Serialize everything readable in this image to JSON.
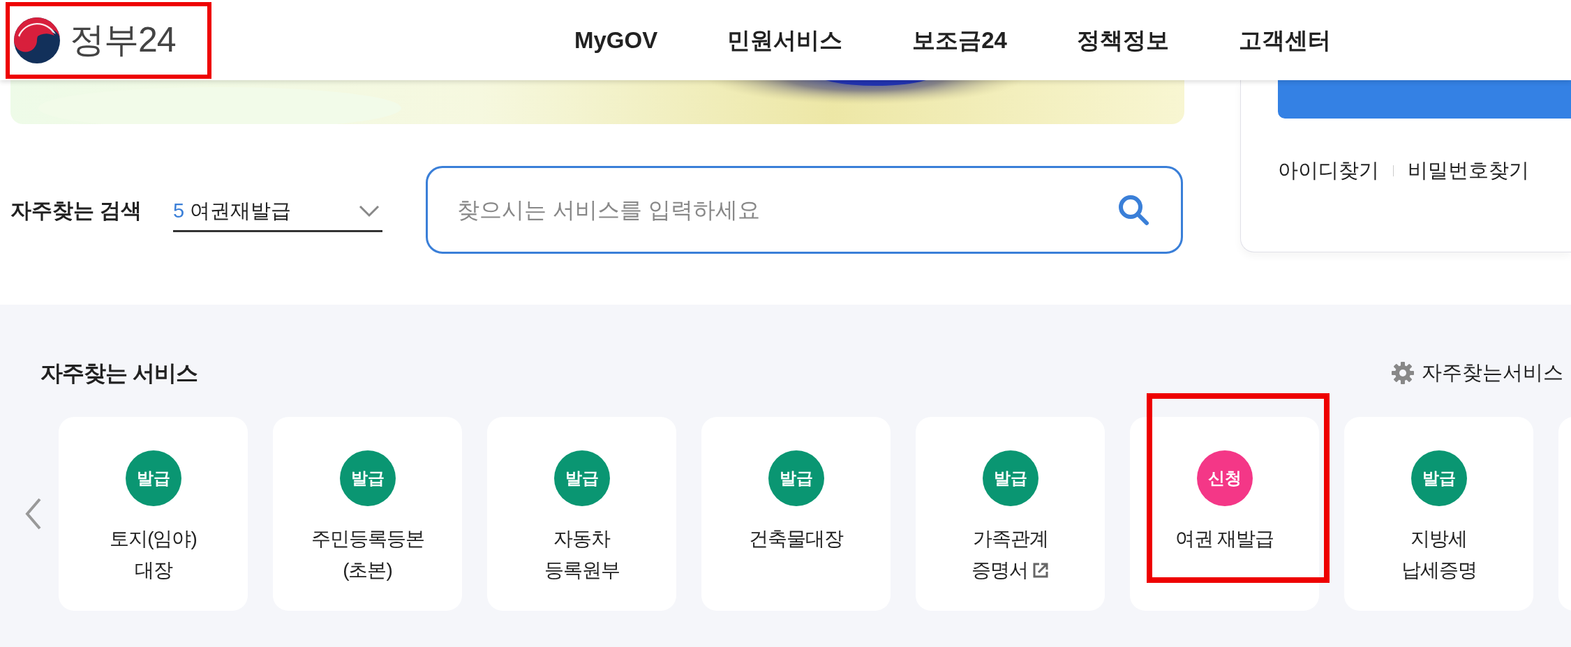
{
  "logo": {
    "text": "정부24",
    "highlighted": true
  },
  "nav": [
    "MyGOV",
    "민원서비스",
    "보조금24",
    "정책정보",
    "고객센터"
  ],
  "account_links": [
    "아이디찾기",
    "비밀번호찾기"
  ],
  "frequent_search": {
    "label": "자주찾는 검색",
    "rank": "5",
    "term": "여권재발급"
  },
  "search": {
    "placeholder": "찾으시는 서비스를 입력하세요"
  },
  "services": {
    "title": "자주찾는 서비스",
    "settings_link": "자주찾는서비스",
    "cards": [
      {
        "badge": "발급",
        "color": "#0a9672",
        "lines": [
          "토지(임야)",
          "대장"
        ],
        "external": false,
        "highlighted": false
      },
      {
        "badge": "발급",
        "color": "#0a9672",
        "lines": [
          "주민등록등본",
          "(초본)"
        ],
        "external": false,
        "highlighted": false
      },
      {
        "badge": "발급",
        "color": "#0a9672",
        "lines": [
          "자동차",
          "등록원부"
        ],
        "external": false,
        "highlighted": false
      },
      {
        "badge": "발급",
        "color": "#0a9672",
        "lines": [
          "건축물대장"
        ],
        "external": false,
        "highlighted": false
      },
      {
        "badge": "발급",
        "color": "#0a9672",
        "lines": [
          "가족관계",
          "증명서"
        ],
        "external": true,
        "highlighted": false
      },
      {
        "badge": "신청",
        "color": "#f43787",
        "lines": [
          "여권 재발급"
        ],
        "external": false,
        "highlighted": true
      },
      {
        "badge": "발급",
        "color": "#0a9672",
        "lines": [
          "지방세",
          "납세증명"
        ],
        "external": false,
        "highlighted": false
      }
    ]
  }
}
